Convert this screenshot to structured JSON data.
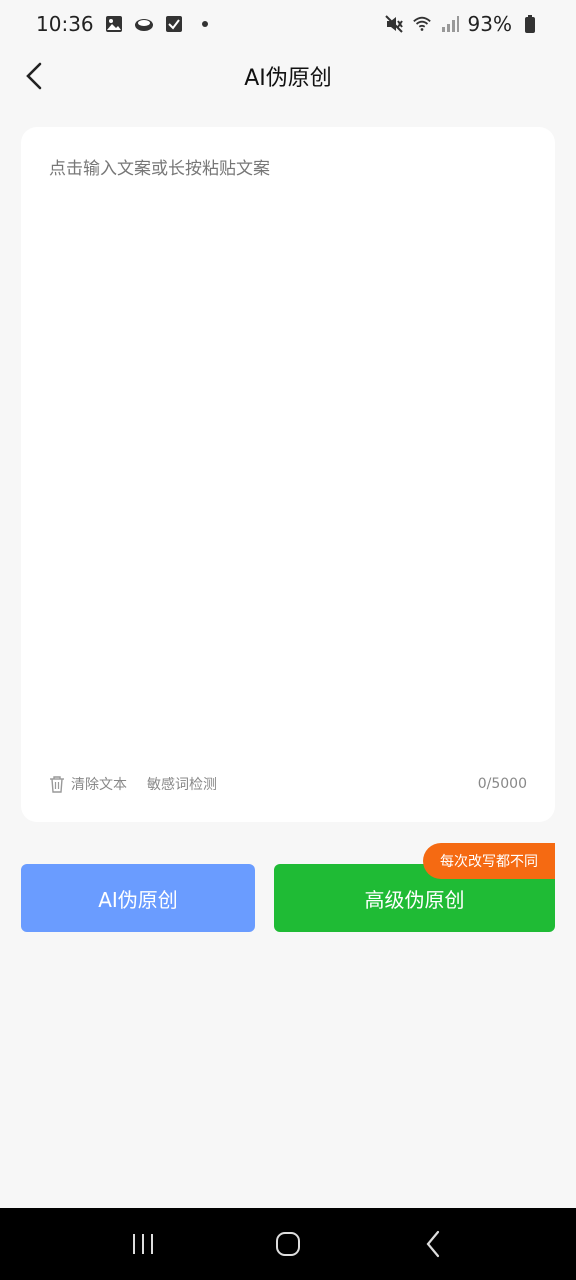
{
  "status_bar": {
    "time": "10:36",
    "battery": "93%",
    "icons": [
      "gallery-icon",
      "cloud-icon",
      "checkbox-icon",
      "mute-icon",
      "wifi-icon",
      "signal-icon",
      "battery-icon"
    ]
  },
  "header": {
    "title": "AI伪原创",
    "back_icon": "back-arrow-icon"
  },
  "editor": {
    "placeholder": "点击输入文案或长按粘贴文案",
    "value": "",
    "clear_label": "清除文本",
    "sensitive_label": "敏感词检测",
    "char_count": "0/5000"
  },
  "actions": {
    "ai_rewrite_label": "AI伪原创",
    "advanced_rewrite_label": "高级伪原创",
    "advanced_badge": "每次改写都不同"
  },
  "colors": {
    "ai_button": "#6a9cff",
    "advanced_button": "#1fbb35",
    "badge": "#f56a12"
  }
}
